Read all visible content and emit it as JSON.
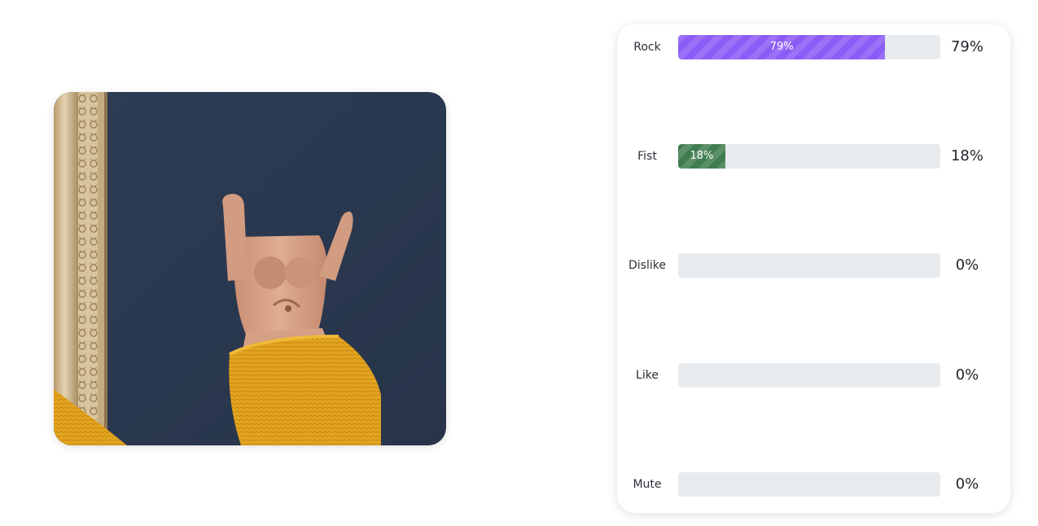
{
  "image": {
    "subject": "hand-rock-gesture-photo",
    "colors": {
      "wall": "#2b3a52",
      "frame": "#cbb58f",
      "sweater": "#e3a51f",
      "skin": "#d9a486"
    }
  },
  "results": {
    "rows": [
      {
        "label": "Rock",
        "fraction": 0.79,
        "fill_label": "79%",
        "value": "79%",
        "color": "#8b5cf6"
      },
      {
        "label": "Fist",
        "fraction": 0.18,
        "fill_label": "18%",
        "value": "18%",
        "color": "#3f7d4f"
      },
      {
        "label": "Dislike",
        "fraction": 0.0,
        "fill_label": "",
        "value": "0%",
        "color": ""
      },
      {
        "label": "Like",
        "fraction": 0.0,
        "fill_label": "",
        "value": "0%",
        "color": ""
      },
      {
        "label": "Mute",
        "fraction": 0.0,
        "fill_label": "",
        "value": "0%",
        "color": ""
      }
    ]
  }
}
